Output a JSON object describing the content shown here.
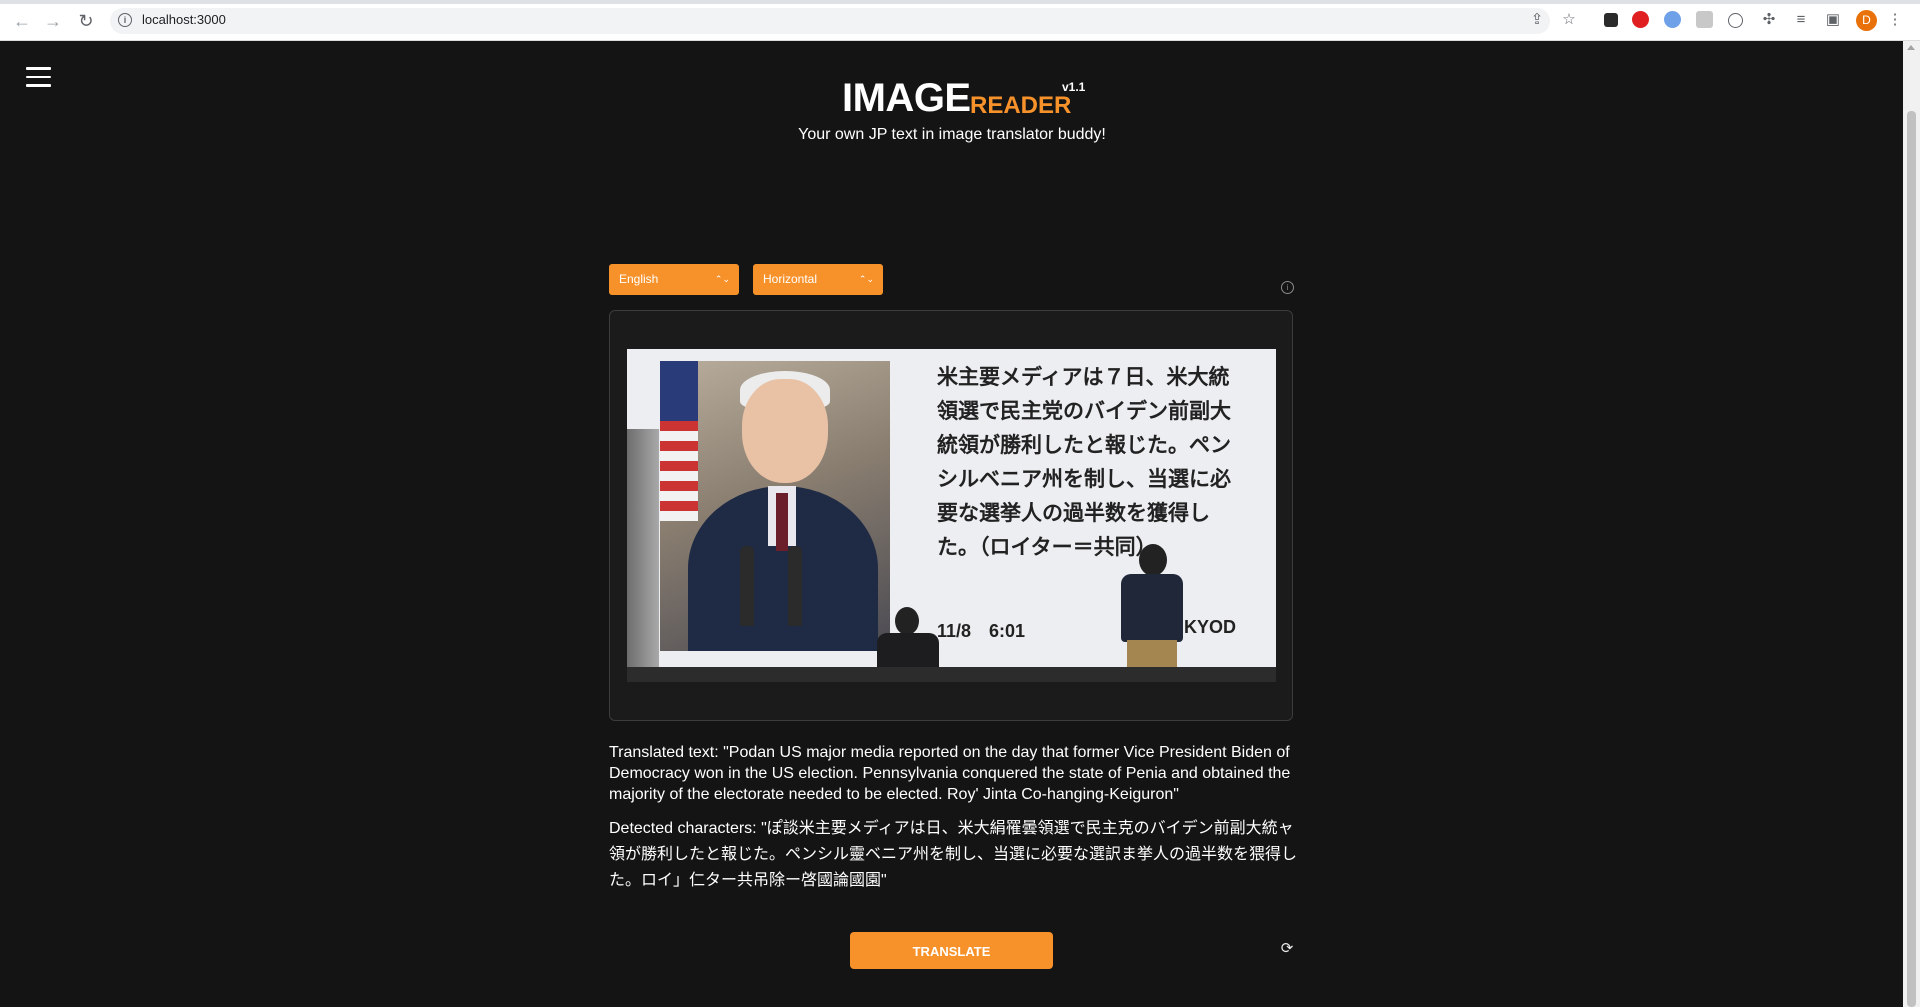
{
  "browser": {
    "url": "localhost:3000",
    "profile_initial": "D"
  },
  "header": {
    "logo_main": "IMAGE",
    "logo_sub": "READER",
    "version": "v1.1",
    "tagline": "Your own JP text in image translator buddy!"
  },
  "controls": {
    "language": "English",
    "orientation": "Horizontal"
  },
  "image": {
    "jp_caption": "米主要メディアは７日、米大統領選で民主党のバイデン前副大統領が勝利したと報じた。ペンシルベニア州を制し、当選に必要な選挙人の過半数を獲得した。（ロイター＝共同）",
    "timestamp": "11/8　6:01",
    "source": "KYOD"
  },
  "results": {
    "translated": "Translated text: \"Podan US major media reported on the day that former Vice President Biden of Democracy won in the US election. Pennsylvania conquered the state of Penia and obtained the majority of the electorate needed to be elected. Roy' Jinta Co-hanging-Keiguron\"",
    "detected": "Detected characters: \"ぽ談米主要メディアは日、米大絹罹曇領選で民主克のバイデン前副大統ャ領が勝利したと報じた。ペンシル靈ベニア州を制し、当選に必要な選訳ま挙人の過半数を猥得した。ロイ」仁ター共吊除ー啓國論國園\""
  },
  "actions": {
    "translate_label": "TRANSLATE"
  }
}
